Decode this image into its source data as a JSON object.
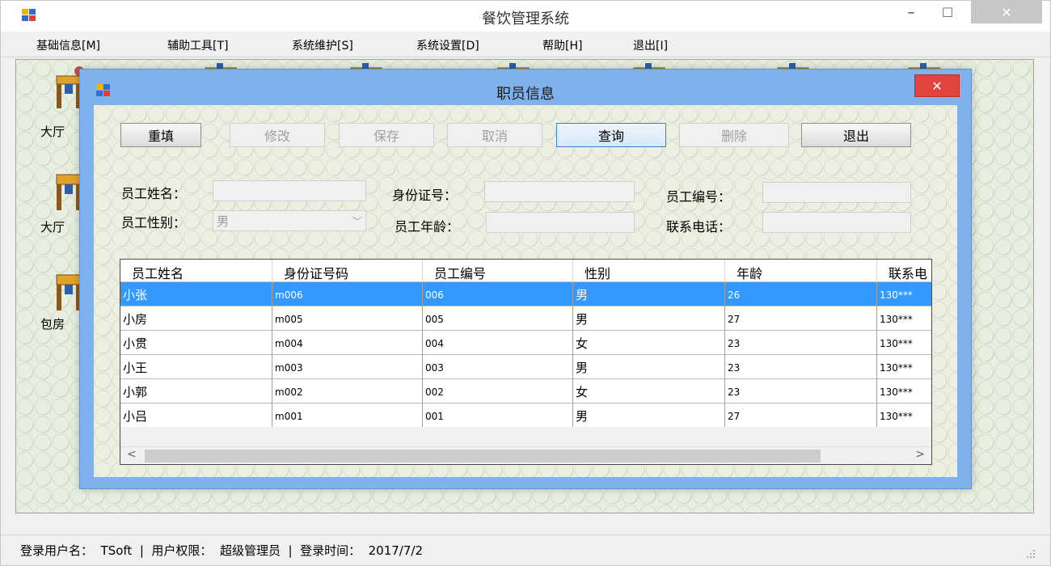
{
  "app": {
    "title": "餐饮管理系统",
    "min_glyph": "–",
    "max_glyph": "☐",
    "close_glyph": "✕"
  },
  "menu": [
    {
      "label": "基础信息[M]"
    },
    {
      "label": "辅助工具[T]"
    },
    {
      "label": "系统维护[S]"
    },
    {
      "label": "系统设置[D]"
    },
    {
      "label": "帮助[H]"
    },
    {
      "label": "退出[I]"
    }
  ],
  "side_labels": [
    "大厅",
    "大厅",
    "包房"
  ],
  "dialog": {
    "title": "职员信息",
    "close_glyph": "✕",
    "buttons": [
      {
        "label": "重填",
        "state": "enabled"
      },
      {
        "label": "修改",
        "state": "disabled"
      },
      {
        "label": "保存",
        "state": "disabled"
      },
      {
        "label": "取消",
        "state": "disabled"
      },
      {
        "label": "查询",
        "state": "focused"
      },
      {
        "label": "删除",
        "state": "disabled"
      },
      {
        "label": "退出",
        "state": "enabled"
      }
    ],
    "form": {
      "name_label": "员工姓名：",
      "name_value": "",
      "id_card_label": "身份证号：",
      "id_card_value": "",
      "emp_no_label": "员工编号：",
      "emp_no_value": "",
      "gender_label": "员工性别：",
      "gender_value": "男",
      "age_label": "员工年龄：",
      "age_value": "",
      "phone_label": "联系电话：",
      "phone_value": ""
    },
    "grid": {
      "columns": [
        "员工姓名",
        "身份证号码",
        "员工编号",
        "性别",
        "年龄",
        "联系电"
      ],
      "rows": [
        [
          "小张",
          "m006",
          "006",
          "男",
          "26",
          "130***"
        ],
        [
          "小房",
          "m005",
          "005",
          "男",
          "27",
          "130***"
        ],
        [
          "小贯",
          "m004",
          "004",
          "女",
          "23",
          "130***"
        ],
        [
          "小王",
          "m003",
          "003",
          "男",
          "23",
          "130***"
        ],
        [
          "小郭",
          "m002",
          "002",
          "女",
          "23",
          "130***"
        ],
        [
          "小吕",
          "m001",
          "001",
          "男",
          "27",
          "130***"
        ]
      ],
      "selected_row": 0,
      "scroll_left_glyph": "<",
      "scroll_right_glyph": ">"
    }
  },
  "status": {
    "text": "登录用户名：  TSoft  |  用户权限：  超级管理员  |  登录时间：  2017/7/2"
  },
  "colors": {
    "dialog_frame": "#7fb2ec",
    "dialog_close": "#e0443d",
    "selection": "#3399ff"
  }
}
